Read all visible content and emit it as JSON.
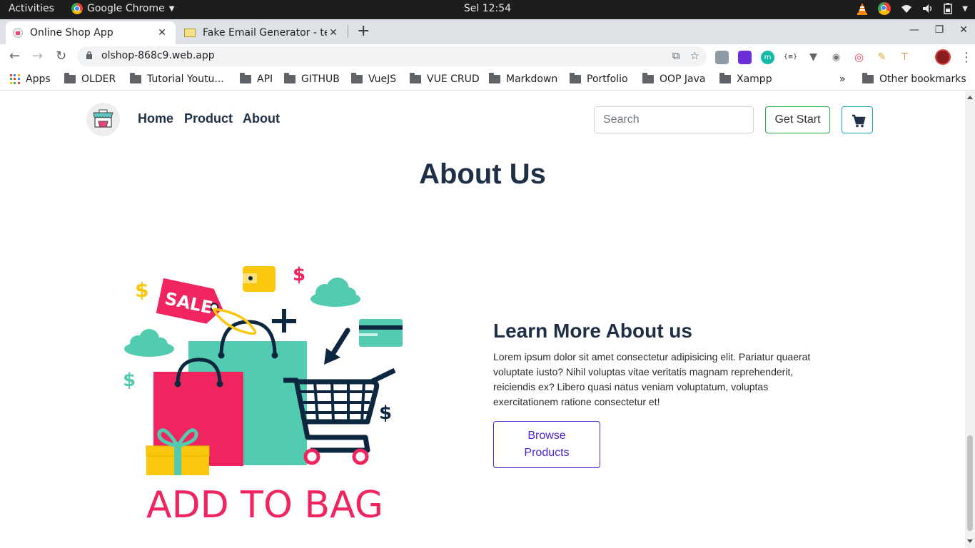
{
  "os_bar": {
    "activities": "Activities",
    "app_name": "Google Chrome",
    "clock": "Sel 12:54"
  },
  "browser": {
    "tabs": [
      {
        "title": "Online Shop App",
        "active": true
      },
      {
        "title": "Fake Email Generator - ten",
        "active": false
      }
    ],
    "url": "olshop-868c9.web.app",
    "bookmarks": [
      "Apps",
      "OLDER",
      "Tutorial Youtu...",
      "API",
      "GITHUB",
      "VueJS",
      "VUE CRUD",
      "Markdown",
      "Portfolio",
      "OOP Java",
      "Xampp"
    ],
    "bookmarks_overflow": "»",
    "other_bookmarks": "Other bookmarks"
  },
  "navbar": {
    "links": [
      "Home",
      "Product",
      "About"
    ],
    "search_placeholder": "Search",
    "get_start": "Get Start",
    "cart_icon": "shopping-cart-icon"
  },
  "about": {
    "title": "About Us",
    "illustration_caption": "ADD TO BAG",
    "illustration_sale_tag": "SALE",
    "heading": "Learn More About us",
    "body": "Lorem ipsum dolor sit amet consectetur adipisicing elit. Pariatur quaerat voluptate iusto? Nihil voluptas vitae veritatis magnam reprehenderit, reiciendis ex? Libero quasi natus veniam voluptatum, voluptas exercitationem ratione consectetur et!",
    "button_line1": "Browse",
    "button_line2": "Products"
  },
  "colors": {
    "pink": "#f0245f",
    "teal": "#52cbb1",
    "yellow": "#f9c80e",
    "navy": "#0e2740",
    "nav_text": "#1f2f45",
    "button_purple": "#4b1fd6",
    "get_start_border": "#28a745",
    "cart_border": "#17a2b8"
  }
}
